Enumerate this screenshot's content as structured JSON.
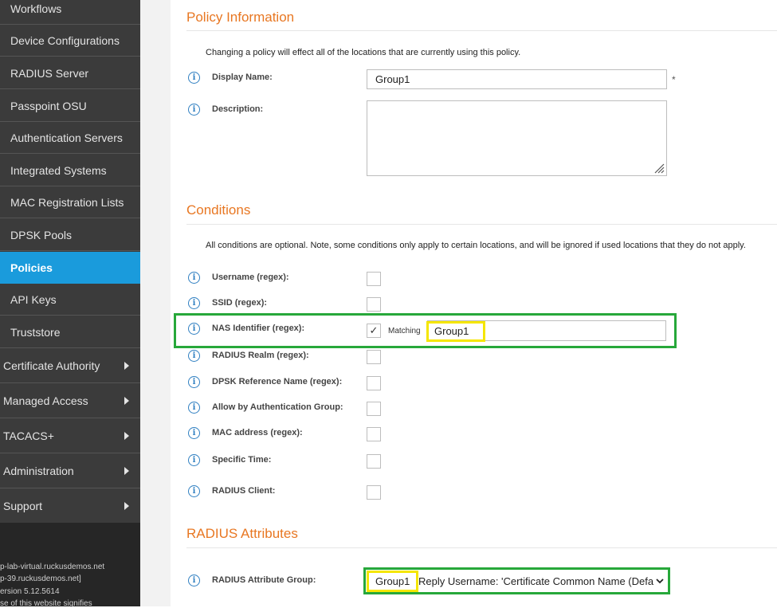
{
  "sidebar": {
    "items": [
      {
        "label": "Workflows"
      },
      {
        "label": "Device Configurations"
      },
      {
        "label": "RADIUS Server"
      },
      {
        "label": "Passpoint OSU"
      },
      {
        "label": "Authentication Servers"
      },
      {
        "label": "Integrated Systems"
      },
      {
        "label": "MAC Registration Lists"
      },
      {
        "label": "DPSK Pools"
      },
      {
        "label": "Policies"
      },
      {
        "label": "API Keys"
      },
      {
        "label": "Truststore"
      }
    ],
    "groups": [
      {
        "label": "Certificate Authority"
      },
      {
        "label": "Managed Access"
      },
      {
        "label": "TACACS+"
      },
      {
        "label": "Administration"
      },
      {
        "label": "Support"
      }
    ],
    "footer": {
      "line1": "p-lab-virtual.ruckusdemos.net",
      "line2": "p-39.ruckusdemos.net]",
      "line3": "ersion 5.12.5614",
      "line4": "se of this website signifies"
    }
  },
  "policy_info": {
    "title": "Policy Information",
    "note": "Changing a policy will effect all of the locations that are currently using this policy.",
    "display_name_label": "Display Name:",
    "display_name_value": "Group1",
    "required_mark": "*",
    "description_label": "Description:"
  },
  "conditions": {
    "title": "Conditions",
    "note": "All conditions are optional. Note, some conditions only apply to certain locations, and will be ignored if used locations that they do not apply.",
    "items": [
      {
        "label": "Username (regex):"
      },
      {
        "label": "SSID (regex):"
      },
      {
        "label": "NAS Identifier (regex):"
      },
      {
        "label": "RADIUS Realm (regex):"
      },
      {
        "label": "DPSK Reference Name (regex):"
      },
      {
        "label": "Allow by Authentication Group:"
      },
      {
        "label": "MAC address (regex):"
      },
      {
        "label": "Specific Time:"
      },
      {
        "label": "RADIUS Client:"
      }
    ],
    "nas_checkmark": "✓",
    "matching_label": "Matching",
    "nas_value": "Group1"
  },
  "radius_attributes": {
    "title": "RADIUS Attributes",
    "group_label": "RADIUS Attribute Group:",
    "group_name": "Group1",
    "group_value": "Reply Username: 'Certificate Common Name (Defa"
  },
  "info_glyph": "i",
  "colors": {
    "accent": "#e87722",
    "active": "#1a9bdc",
    "highlight_green": "#27a83a",
    "highlight_yellow": "#f5e600"
  }
}
